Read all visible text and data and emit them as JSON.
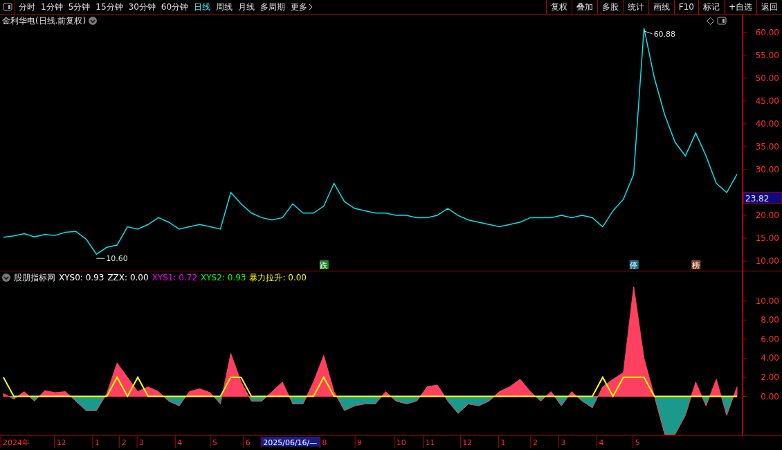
{
  "toolbar": {
    "periods": [
      {
        "label": "分时",
        "selected": false
      },
      {
        "label": "1分钟",
        "selected": false
      },
      {
        "label": "5分钟",
        "selected": false
      },
      {
        "label": "15分钟",
        "selected": false
      },
      {
        "label": "30分钟",
        "selected": false
      },
      {
        "label": "60分钟",
        "selected": false
      },
      {
        "label": "日线",
        "selected": true
      },
      {
        "label": "周线",
        "selected": false
      },
      {
        "label": "月线",
        "selected": false
      },
      {
        "label": "多周期",
        "selected": false
      },
      {
        "label": "更多",
        "selected": false
      }
    ],
    "actions": [
      "复权",
      "叠加",
      "多股",
      "统计",
      "画线",
      "F10",
      "标记",
      "+自选",
      "返回"
    ]
  },
  "price_panel": {
    "title": "金利华电(日线.前复权)",
    "current_price": "23.82",
    "low_label": "10.60",
    "high_label": "60.88",
    "event_tags": [
      {
        "label": "跌",
        "color": "#1a8a2a"
      },
      {
        "label": "停",
        "color": "#1c6f86"
      },
      {
        "label": "榜",
        "color": "#8a4a2a"
      }
    ],
    "chart_data": {
      "type": "line",
      "ylim": [
        7.9,
        63.9
      ],
      "yticks": [
        {
          "value": 10,
          "label": "10.00"
        },
        {
          "value": 15,
          "label": "15.00"
        },
        {
          "value": 20,
          "label": "20.00"
        },
        {
          "value": 30,
          "label": "30.00"
        },
        {
          "value": 35,
          "label": "35.00"
        },
        {
          "value": 40,
          "label": "40.00"
        },
        {
          "value": 45,
          "label": "45.00"
        },
        {
          "value": 50,
          "label": "50.00"
        },
        {
          "value": 55,
          "label": "55.00"
        },
        {
          "value": 60,
          "label": "60.00"
        }
      ],
      "series": [
        {
          "color": "#00e5ee",
          "values": [
            15.2,
            15.5,
            16,
            15.3,
            15.8,
            15.6,
            16.3,
            16.5,
            14.8,
            11.5,
            13,
            13.5,
            17.5,
            17,
            18,
            19.5,
            18.5,
            17,
            17.5,
            18,
            17.5,
            17,
            25,
            22.5,
            20.5,
            19.5,
            19,
            19.5,
            22.5,
            20.5,
            20.5,
            22,
            27,
            23,
            21.5,
            21,
            20.5,
            20.5,
            20,
            20,
            19.5,
            19.5,
            20,
            21.5,
            20,
            19,
            18.5,
            18,
            17.5,
            18,
            18.5,
            19.5,
            19.5,
            19.5,
            20,
            19.5,
            20,
            19.5,
            17.5,
            21,
            23.5,
            29,
            60.9,
            50,
            42,
            36,
            33,
            38,
            33,
            27,
            25,
            29
          ]
        }
      ]
    }
  },
  "indicator_panel": {
    "name": "股朋指标网",
    "readouts": [
      {
        "label": "XYS0: 0.93",
        "color": "#ffffff"
      },
      {
        "label": "ZZX: 0.00",
        "color": "#ffffff"
      },
      {
        "label": "XYS1: 0.72",
        "color": "#ff00ff"
      },
      {
        "label": "XYS2: 0.93",
        "color": "#00ff00"
      },
      {
        "label": "暴力拉升: 0.00",
        "color": "#ffff00"
      }
    ],
    "chart_data": {
      "type": "area",
      "ylim": [
        -4.1,
        13.1
      ],
      "yticks": [
        {
          "value": 0,
          "label": "0.00"
        },
        {
          "value": 2,
          "label": "2.00"
        },
        {
          "value": 4,
          "label": "4.00"
        },
        {
          "value": 6,
          "label": "6.00"
        },
        {
          "value": 8,
          "label": "8.00"
        },
        {
          "value": 10,
          "label": "10.00"
        }
      ],
      "series": [
        {
          "color": "#ff4060",
          "values": [
            0.3,
            -0.3,
            0.5,
            -0.5,
            0.6,
            0.4,
            0.5,
            -0.5,
            -1.5,
            -1.5,
            0.3,
            3.5,
            2,
            0.5,
            1,
            0.5,
            -0.5,
            -1,
            0.5,
            0.8,
            0.4,
            -0.8,
            4.5,
            1.5,
            -0.5,
            -0.5,
            0.5,
            1.5,
            -0.8,
            -0.8,
            1.5,
            4.3,
            0.5,
            -1.5,
            -1,
            -0.8,
            -0.8,
            0.5,
            -0.5,
            -0.8,
            -0.5,
            1,
            1.2,
            -0.5,
            -1.8,
            -0.8,
            -1,
            -0.5,
            0.5,
            1,
            1.8,
            0.5,
            -0.5,
            0.5,
            -1,
            0.5,
            -0.5,
            -1.2,
            1,
            1.8,
            2.5,
            11.5,
            4,
            0,
            -4,
            -4,
            -2,
            1.5,
            -1,
            1.8,
            -2,
            1
          ]
        },
        {
          "type": "line",
          "color": "#ffff00",
          "values": [
            2,
            0,
            0,
            0,
            0,
            0,
            0,
            0,
            0,
            0,
            0,
            2,
            0,
            2,
            0,
            0,
            0,
            0,
            0,
            0,
            0,
            0,
            2,
            2,
            0,
            0,
            0,
            0,
            0,
            0,
            0,
            2,
            0,
            0,
            0,
            0,
            0,
            0,
            0,
            0,
            0,
            0,
            0,
            0,
            0,
            0,
            0,
            0,
            0,
            0,
            0,
            0,
            0,
            0,
            0,
            0,
            0,
            0,
            2,
            0,
            2,
            2,
            2,
            0,
            0,
            0,
            0,
            0,
            0,
            0,
            0,
            0
          ]
        }
      ]
    }
  },
  "date_axis": {
    "ticks": [
      {
        "label": "2024年",
        "selected": false
      },
      {
        "label": "12",
        "selected": false
      },
      {
        "label": "1",
        "selected": false
      },
      {
        "label": "2",
        "selected": false
      },
      {
        "label": "3",
        "selected": false
      },
      {
        "label": "4",
        "selected": false
      },
      {
        "label": "5",
        "selected": false
      },
      {
        "label": "6",
        "selected": false
      },
      {
        "label": "2025/06/16/—",
        "selected": true
      },
      {
        "label": "8",
        "selected": false
      },
      {
        "label": "9",
        "selected": false
      },
      {
        "label": "10",
        "selected": false
      },
      {
        "label": "11",
        "selected": false
      },
      {
        "label": "12",
        "selected": false
      },
      {
        "label": "1",
        "selected": false
      },
      {
        "label": "2",
        "selected": false
      },
      {
        "label": "3",
        "selected": false
      },
      {
        "label": "4",
        "selected": false
      },
      {
        "label": "5",
        "selected": false
      }
    ]
  }
}
